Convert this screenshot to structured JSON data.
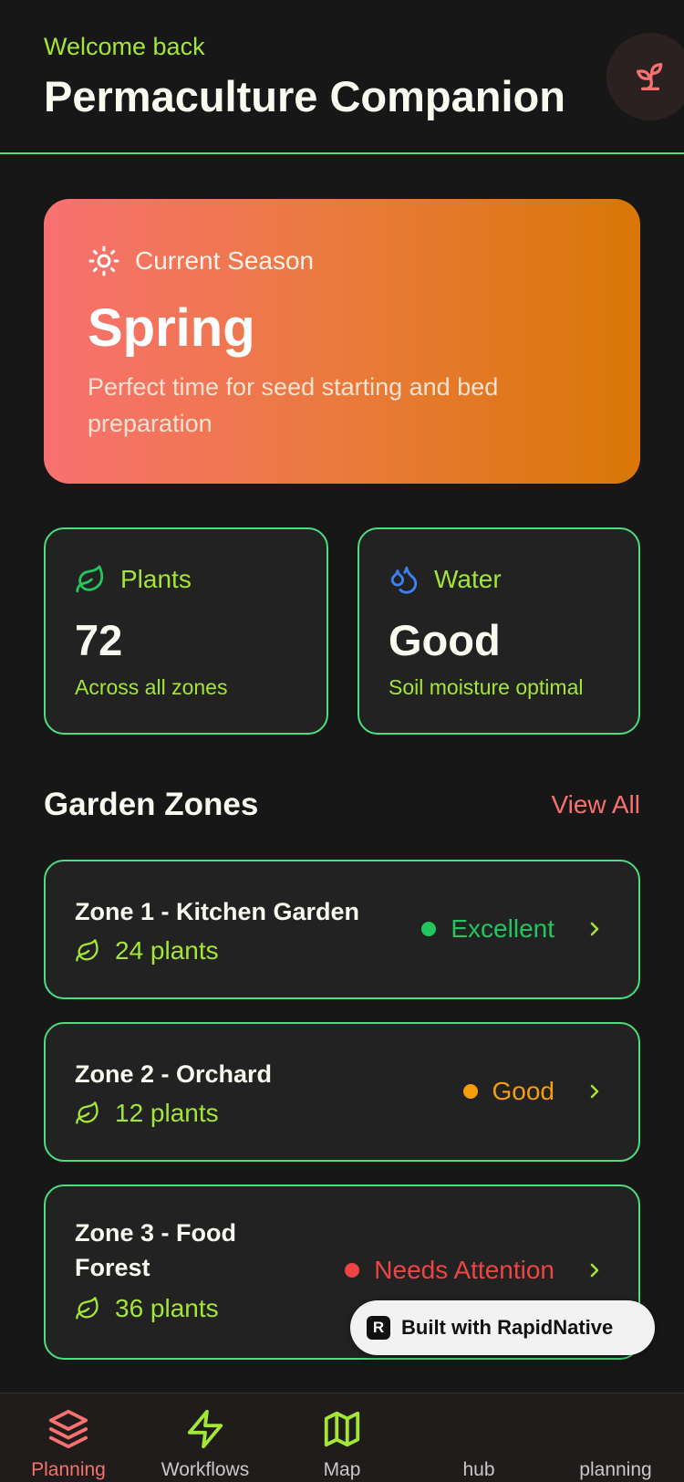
{
  "header": {
    "welcome": "Welcome back",
    "title": "Permaculture Companion",
    "avatar_icon": "sprout-icon"
  },
  "season": {
    "label": "Current Season",
    "name": "Spring",
    "description": "Perfect time for seed starting and bed preparation",
    "icon": "sun-icon"
  },
  "stats": [
    {
      "label": "Plants",
      "value": "72",
      "subtitle": "Across all zones",
      "icon": "leaf-icon"
    },
    {
      "label": "Water",
      "value": "Good",
      "subtitle": "Soil moisture optimal",
      "icon": "droplets-icon"
    }
  ],
  "zones_section": {
    "title": "Garden Zones",
    "view_all": "View All"
  },
  "zones": [
    {
      "name": "Zone 1 - Kitchen Garden",
      "plants": "24 plants",
      "status": "Excellent",
      "status_color": "#22c55e"
    },
    {
      "name": "Zone 2 - Orchard",
      "plants": "12 plants",
      "status": "Good",
      "status_color": "#f59e0b"
    },
    {
      "name_line1": "Zone 3 - Food",
      "name_line2": "Forest",
      "plants": "36 plants",
      "status": "Needs Attention",
      "status_color": "#ef4444"
    }
  ],
  "badge": {
    "text": "Built with RapidNative"
  },
  "tabs": [
    {
      "label": "Planning",
      "icon": "layers-icon",
      "active": true
    },
    {
      "label": "Workflows",
      "icon": "zap-icon"
    },
    {
      "label": "Map",
      "icon": "map-icon"
    },
    {
      "label": "hub",
      "icon": ""
    },
    {
      "label": "planning",
      "icon": ""
    }
  ],
  "colors": {
    "accent_green": "#4ade80",
    "lime": "#a3e635",
    "coral": "#f87171",
    "background": "#171717"
  }
}
